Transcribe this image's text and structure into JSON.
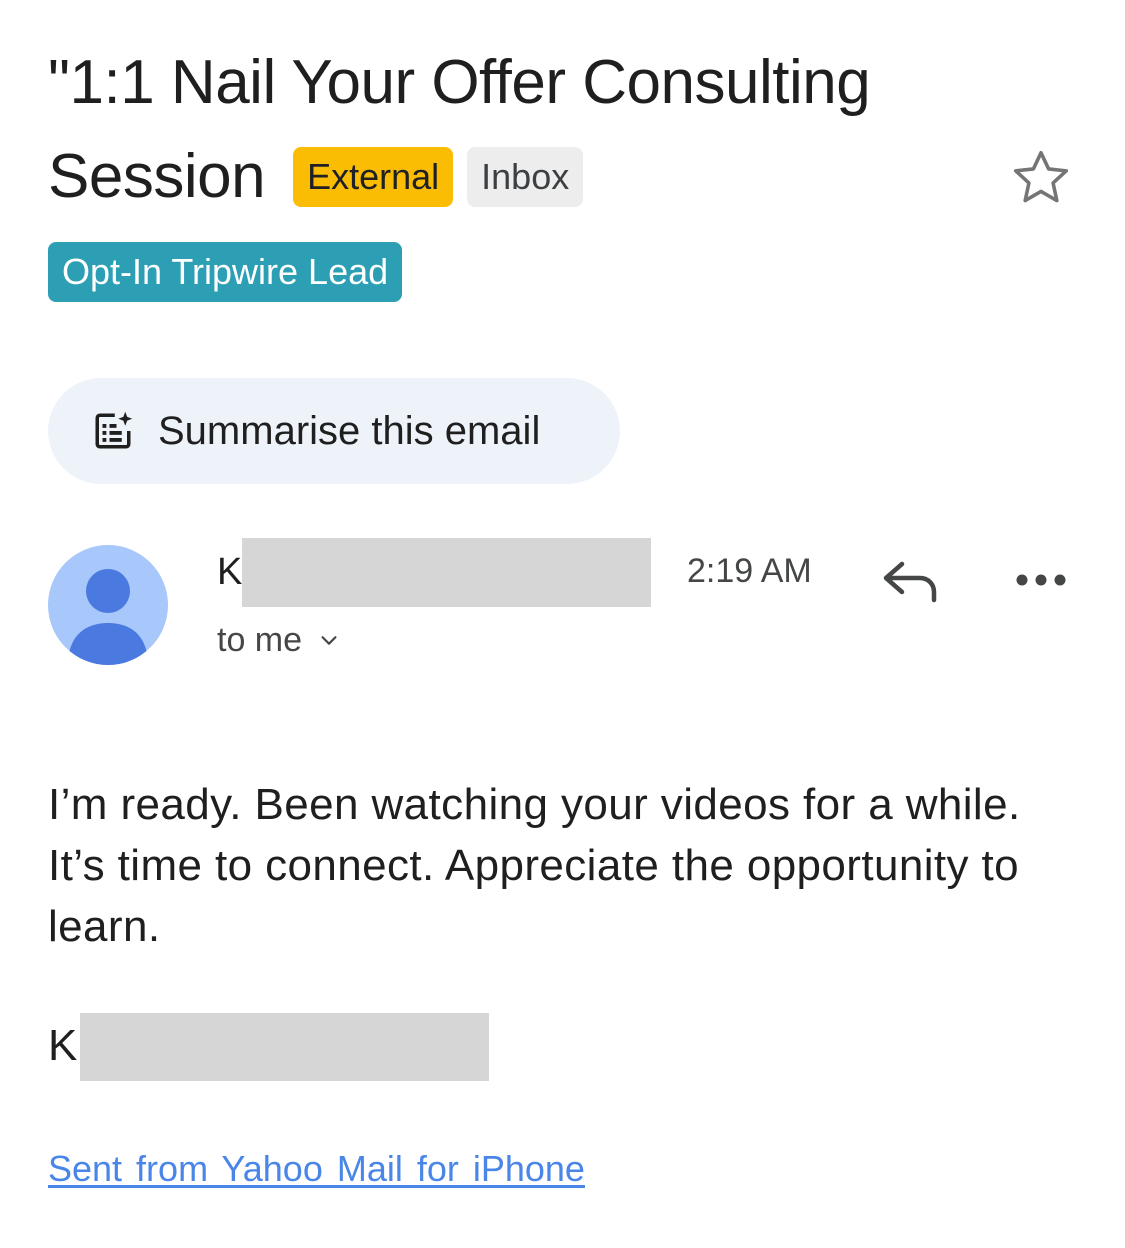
{
  "email": {
    "subject_line1": "\"1:1 Nail Your Offer Consulting",
    "subject_line2": "Session",
    "chips": {
      "external": "External",
      "inbox": "Inbox",
      "label": "Opt-In Tripwire Lead"
    },
    "star_icon": "star-outline-icon"
  },
  "summarise": {
    "label": "Summarise this email",
    "icon": "summarise-sparkle-icon"
  },
  "sender": {
    "initial": "K",
    "recipient": "to me",
    "time": "2:19 AM"
  },
  "actions": {
    "reply_icon": "reply-icon",
    "more_icon": "more-horizontal-icon"
  },
  "body": {
    "text": "I’m ready. Been watching your videos for a while. It’s time to connect. Appreciate the opportunity to learn.",
    "signature_initial": "K",
    "footer_link": "Sent from Yahoo Mail for iPhone"
  },
  "colors": {
    "external_chip": "#fbbc04",
    "inbox_chip": "#ededed",
    "label_chip": "#2c9fb5",
    "summarise_bg": "#eef3fa",
    "avatar_bg": "#a8c7fa",
    "avatar_fg": "#4a7ae0",
    "link": "#4a86e8",
    "redaction": "#d6d6d6"
  }
}
